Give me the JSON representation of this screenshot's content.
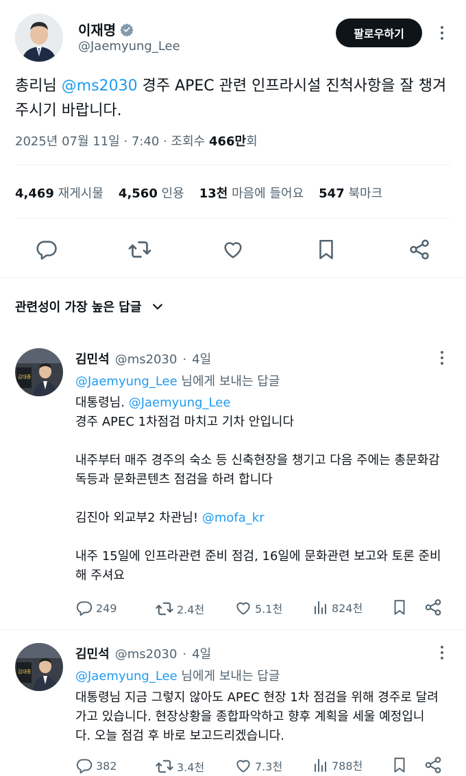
{
  "author": {
    "name": "이재명",
    "handle": "@Jaemyung_Lee",
    "follow_label": "팔로우하기"
  },
  "post": {
    "text_prefix": "총리님 ",
    "mention": "@ms2030",
    "text_suffix": " 경주 APEC 관련 인프라시설 진척사항을 잘 챙겨주시기 바랍니다.",
    "date": "2025년 07월 11일",
    "time": "7:40",
    "views_label": "조회수",
    "views_value": "466만",
    "views_unit": "회"
  },
  "stats": [
    {
      "value": "4,469",
      "label": "재게시물"
    },
    {
      "value": "4,560",
      "label": "인용"
    },
    {
      "value": "13천",
      "label": "마음에 들어요"
    },
    {
      "value": "547",
      "label": "북마크"
    }
  ],
  "replies_sort_label": "관련성이 가장 높은 답글",
  "replies": [
    {
      "name": "김민석",
      "handle": "@ms2030",
      "age": "4일",
      "replying_to": "@Jaemyung_Lee",
      "replying_suffix": " 님에게 보내는 답글",
      "line1_prefix": "대통령님. ",
      "line1_mention": "@Jaemyung_Lee",
      "line2": "경주 APEC 1차점검 마치고 기차 안입니다",
      "para2": "내주부터 매주 경주의 숙소 등 신축현장을 챙기고 다음 주에는 총문화감독등과 문화콘텐츠 점검을 하려 합니다",
      "para3_prefix": "김진아 외교부2 차관님! ",
      "para3_mention": "@mofa_kr",
      "para4": "내주 15일에 인프라관련 준비 점검, 16일에 문화관련 보고와 토론 준비해 주셔요",
      "replies_count": "249",
      "reposts": "2.4천",
      "likes": "5.1천",
      "views": "824천"
    },
    {
      "name": "김민석",
      "handle": "@ms2030",
      "age": "4일",
      "replying_to": "@Jaemyung_Lee",
      "replying_suffix": " 님에게 보내는 답글",
      "text": "대통령님 지금 그렇지 않아도 APEC 현장 1차 점검을 위해 경주로 달려가고 있습니다. 현장상황을 종합파악하고 향후 계획을 세울 예정입니다. 오늘 점검 후 바로 보고드리겠습니다.",
      "replies_count": "382",
      "reposts": "3.4천",
      "likes": "7.3천",
      "views": "788천"
    }
  ],
  "colors": {
    "accent": "#1d9bf0",
    "text": "#0f1419",
    "secondary": "#536471",
    "divider": "#eff3f4"
  }
}
